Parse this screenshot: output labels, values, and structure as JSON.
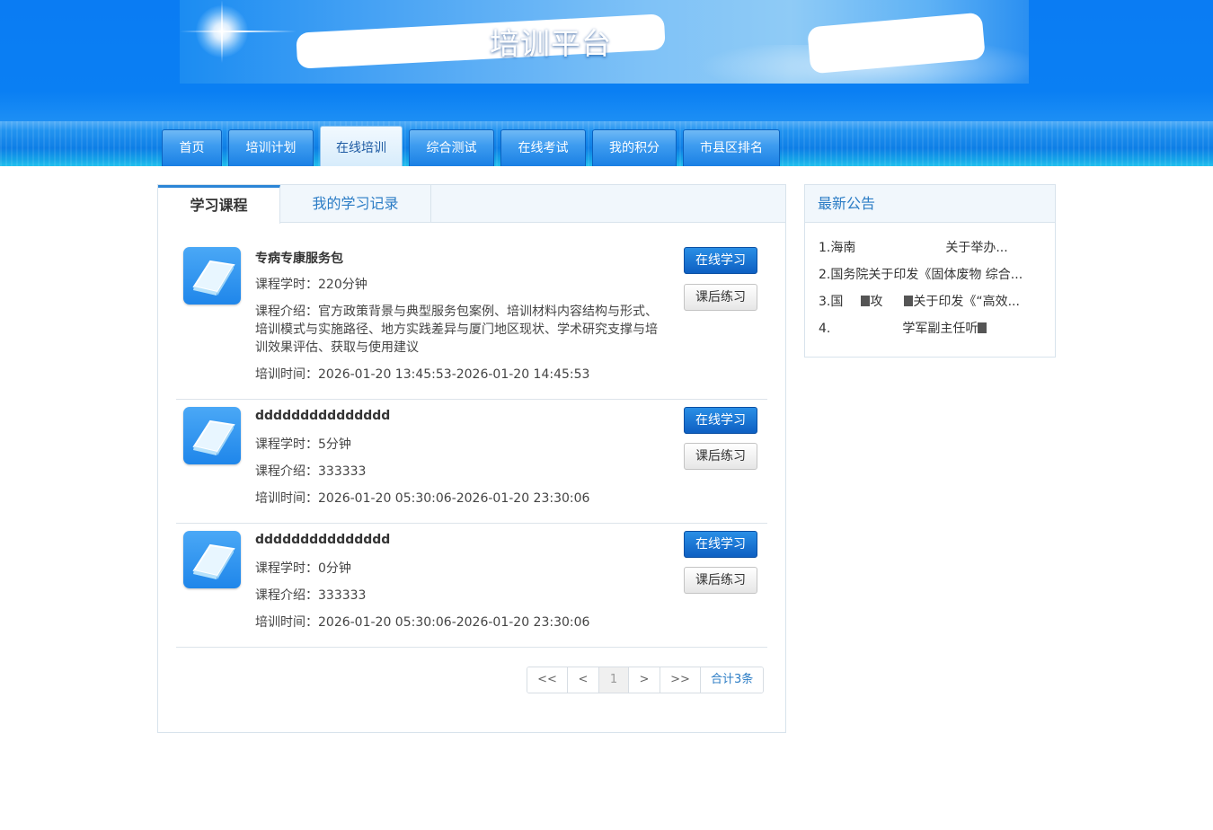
{
  "header": {
    "site_title": "培训平台"
  },
  "nav": {
    "items": [
      {
        "label": "首页",
        "active": false
      },
      {
        "label": "培训计划",
        "active": false
      },
      {
        "label": "在线培训",
        "active": true
      },
      {
        "label": "综合测试",
        "active": false
      },
      {
        "label": "在线考试",
        "active": false
      },
      {
        "label": "我的积分",
        "active": false
      },
      {
        "label": "市县区排名",
        "active": false
      }
    ]
  },
  "main": {
    "tabs": [
      {
        "label": "学习课程",
        "active": true
      },
      {
        "label": "我的学习记录",
        "active": false
      }
    ],
    "courses": [
      {
        "name": "专病专康服务包",
        "hours": "课程学时：220分钟",
        "intro": "课程介绍：官方政策背景与典型服务包案例、培训材料内容结构与形式、培训模式与实施路径、地方实践差异与厦门地区现状、学术研究支撑与培训效果评估、获取与使用建议",
        "time": "培训时间：2026-01-20 13:45:53-2026-01-20 14:45:53",
        "study_label": "在线学习",
        "practice_label": "课后练习"
      },
      {
        "name": "ddddddddddddddd",
        "hours": "课程学时：5分钟",
        "intro": "课程介绍：333333",
        "time": "培训时间：2026-01-20 05:30:06-2026-01-20 23:30:06",
        "study_label": "在线学习",
        "practice_label": "课后练习"
      },
      {
        "name": "ddddddddddddddd",
        "hours": "课程学时：0分钟",
        "intro": "课程介绍：333333",
        "time": "培训时间：2026-01-20 05:30:06-2026-01-20 23:30:06",
        "study_label": "在线学习",
        "practice_label": "课后练习"
      }
    ],
    "pager": {
      "first": "<<",
      "prev": "<",
      "current": "1",
      "next": ">",
      "last": ">>",
      "total": "合计3条"
    }
  },
  "sidebar": {
    "title": "最新公告",
    "notices": [
      {
        "a": "1.海南",
        "b": "关于举办..."
      },
      {
        "a": "2.国务院关于印发《固体废物 综合..."
      },
      {
        "a": "3.国",
        "b": "攻",
        "c": "关于印发《“高效..."
      },
      {
        "a": "4.",
        "b": "学军副主任听"
      }
    ]
  },
  "colors": {
    "header_blue": "#0a7cf3",
    "primary_button": "#1570d6",
    "link_blue": "#2b7cc5"
  }
}
